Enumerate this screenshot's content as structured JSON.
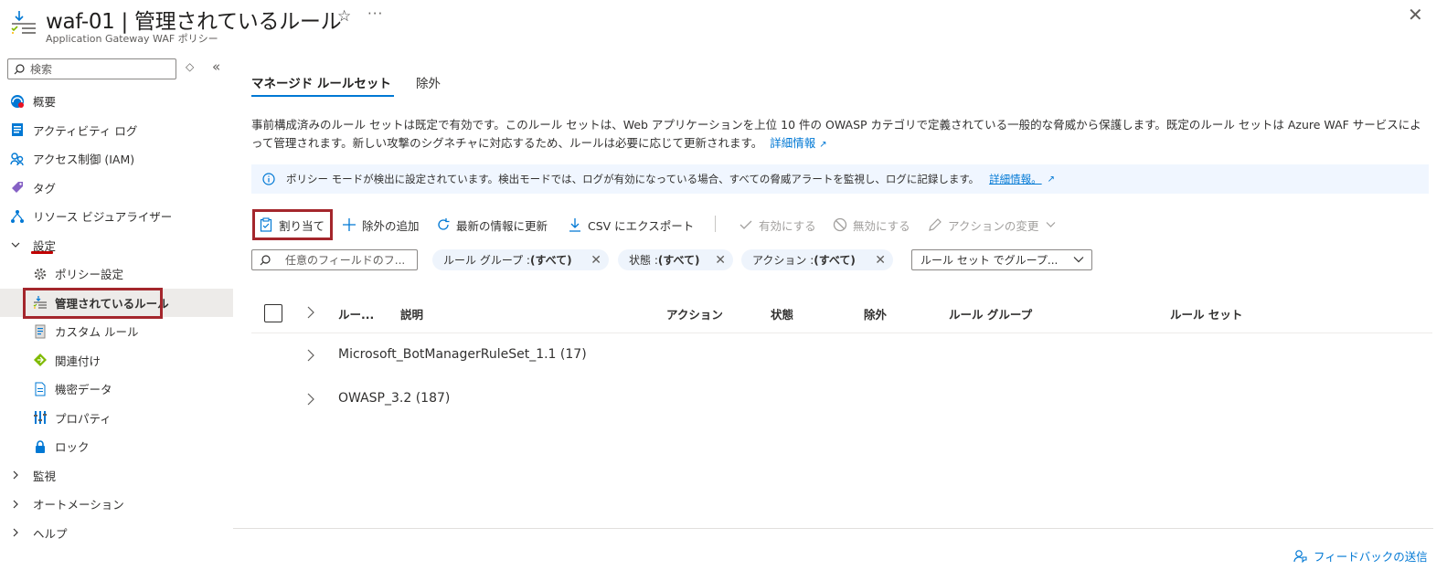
{
  "header": {
    "title": "waf-01 | 管理されているルール",
    "subtitle": "Application Gateway WAF ポリシー",
    "star_icon": "star-icon",
    "more_icon": "more-icon",
    "close_icon": "close-icon"
  },
  "sidebar": {
    "search_placeholder": "検索",
    "items": [
      {
        "label": "概要",
        "icon": "overview-icon"
      },
      {
        "label": "アクティビティ ログ",
        "icon": "activity-log-icon"
      },
      {
        "label": "アクセス制御 (IAM)",
        "icon": "iam-icon"
      },
      {
        "label": "タグ",
        "icon": "tag-icon"
      },
      {
        "label": "リソース ビジュアライザー",
        "icon": "visualizer-icon"
      },
      {
        "label": "設定",
        "icon": "chevron-down-icon"
      },
      {
        "label": "ポリシー設定",
        "icon": "gear-icon"
      },
      {
        "label": "管理されているルール",
        "icon": "managed-rules-icon",
        "selected": true
      },
      {
        "label": "カスタム ルール",
        "icon": "custom-rules-icon"
      },
      {
        "label": "関連付け",
        "icon": "association-icon"
      },
      {
        "label": "機密データ",
        "icon": "sensitive-data-icon"
      },
      {
        "label": "プロパティ",
        "icon": "properties-icon"
      },
      {
        "label": "ロック",
        "icon": "lock-icon"
      },
      {
        "label": "監視",
        "icon": "chevron-right-icon"
      },
      {
        "label": "オートメーション",
        "icon": "chevron-right-icon"
      },
      {
        "label": "ヘルプ",
        "icon": "chevron-right-icon"
      }
    ]
  },
  "tabs": [
    {
      "label": "マネージド ルールセット",
      "active": true
    },
    {
      "label": "除外",
      "active": false
    }
  ],
  "description": {
    "text": "事前構成済みのルール セットは既定で有効です。このルール セットは、Web アプリケーションを上位 10 件の OWASP カテゴリで定義されている一般的な脅威から保護します。既定のルール セットは Azure WAF サービスによって管理されます。新しい攻撃のシグネチャに対応するため、ルールは必要に応じて更新されます。",
    "link": "詳細情報"
  },
  "info_bar": {
    "text": "ポリシー モードが検出に設定されています。検出モードでは、ログが有効になっている場合、すべての脅威アラートを監視し、ログに記録します。",
    "link": "詳細情報。"
  },
  "toolbar": {
    "assign": "割り当て",
    "add_exclusion": "除外の追加",
    "refresh": "最新の情報に更新",
    "export_csv": "CSV にエクスポート",
    "enable": "有効にする",
    "disable": "無効にする",
    "change_action": "アクションの変更"
  },
  "filters": {
    "search_placeholder": "任意のフィールドのフ...",
    "rule_group_label": "ルール グループ : ",
    "rule_group_value": "(すべて)",
    "state_label": "状態 : ",
    "state_value": "(すべて)",
    "action_label": "アクション : ",
    "action_value": "(すべて)",
    "group_by": "ルール セット でグループ..."
  },
  "table": {
    "columns": [
      "ルー...",
      "説明",
      "アクション",
      "状態",
      "除外",
      "ルール グループ",
      "ルール セット"
    ],
    "rows": [
      "Microsoft_BotManagerRuleSet_1.1 (17)",
      "OWASP_3.2 (187)"
    ]
  },
  "footer": {
    "feedback": "フィードバックの送信"
  },
  "colors": {
    "accent": "#0078d4",
    "highlight_border": "#a4262c",
    "info_bg": "#f0f6ff",
    "selected_bg": "#edebe9"
  }
}
